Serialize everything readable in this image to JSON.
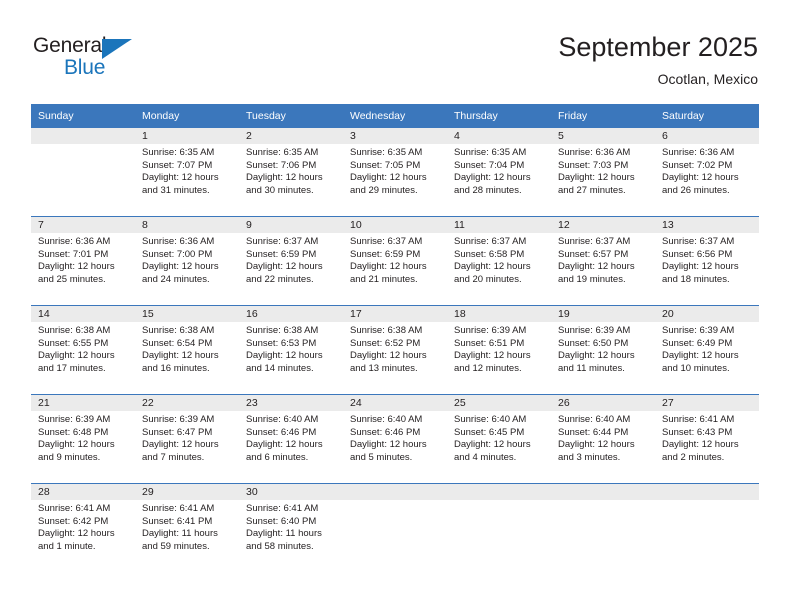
{
  "brand": {
    "name_part1": "General",
    "name_part2": "Blue",
    "triangle_icon": "triangle-icon",
    "accent_color": "#1b75bb"
  },
  "header": {
    "title": "September 2025",
    "subtitle": "Ocotlan, Mexico"
  },
  "calendar": {
    "header_color": "#3b77bc",
    "weekday_headers": [
      "Sunday",
      "Monday",
      "Tuesday",
      "Wednesday",
      "Thursday",
      "Friday",
      "Saturday"
    ],
    "weeks": [
      [
        {
          "day": "",
          "sunrise": "",
          "sunset": "",
          "daylight1": "",
          "daylight2": ""
        },
        {
          "day": "1",
          "sunrise": "Sunrise: 6:35 AM",
          "sunset": "Sunset: 7:07 PM",
          "daylight1": "Daylight: 12 hours",
          "daylight2": "and 31 minutes."
        },
        {
          "day": "2",
          "sunrise": "Sunrise: 6:35 AM",
          "sunset": "Sunset: 7:06 PM",
          "daylight1": "Daylight: 12 hours",
          "daylight2": "and 30 minutes."
        },
        {
          "day": "3",
          "sunrise": "Sunrise: 6:35 AM",
          "sunset": "Sunset: 7:05 PM",
          "daylight1": "Daylight: 12 hours",
          "daylight2": "and 29 minutes."
        },
        {
          "day": "4",
          "sunrise": "Sunrise: 6:35 AM",
          "sunset": "Sunset: 7:04 PM",
          "daylight1": "Daylight: 12 hours",
          "daylight2": "and 28 minutes."
        },
        {
          "day": "5",
          "sunrise": "Sunrise: 6:36 AM",
          "sunset": "Sunset: 7:03 PM",
          "daylight1": "Daylight: 12 hours",
          "daylight2": "and 27 minutes."
        },
        {
          "day": "6",
          "sunrise": "Sunrise: 6:36 AM",
          "sunset": "Sunset: 7:02 PM",
          "daylight1": "Daylight: 12 hours",
          "daylight2": "and 26 minutes."
        }
      ],
      [
        {
          "day": "7",
          "sunrise": "Sunrise: 6:36 AM",
          "sunset": "Sunset: 7:01 PM",
          "daylight1": "Daylight: 12 hours",
          "daylight2": "and 25 minutes."
        },
        {
          "day": "8",
          "sunrise": "Sunrise: 6:36 AM",
          "sunset": "Sunset: 7:00 PM",
          "daylight1": "Daylight: 12 hours",
          "daylight2": "and 24 minutes."
        },
        {
          "day": "9",
          "sunrise": "Sunrise: 6:37 AM",
          "sunset": "Sunset: 6:59 PM",
          "daylight1": "Daylight: 12 hours",
          "daylight2": "and 22 minutes."
        },
        {
          "day": "10",
          "sunrise": "Sunrise: 6:37 AM",
          "sunset": "Sunset: 6:59 PM",
          "daylight1": "Daylight: 12 hours",
          "daylight2": "and 21 minutes."
        },
        {
          "day": "11",
          "sunrise": "Sunrise: 6:37 AM",
          "sunset": "Sunset: 6:58 PM",
          "daylight1": "Daylight: 12 hours",
          "daylight2": "and 20 minutes."
        },
        {
          "day": "12",
          "sunrise": "Sunrise: 6:37 AM",
          "sunset": "Sunset: 6:57 PM",
          "daylight1": "Daylight: 12 hours",
          "daylight2": "and 19 minutes."
        },
        {
          "day": "13",
          "sunrise": "Sunrise: 6:37 AM",
          "sunset": "Sunset: 6:56 PM",
          "daylight1": "Daylight: 12 hours",
          "daylight2": "and 18 minutes."
        }
      ],
      [
        {
          "day": "14",
          "sunrise": "Sunrise: 6:38 AM",
          "sunset": "Sunset: 6:55 PM",
          "daylight1": "Daylight: 12 hours",
          "daylight2": "and 17 minutes."
        },
        {
          "day": "15",
          "sunrise": "Sunrise: 6:38 AM",
          "sunset": "Sunset: 6:54 PM",
          "daylight1": "Daylight: 12 hours",
          "daylight2": "and 16 minutes."
        },
        {
          "day": "16",
          "sunrise": "Sunrise: 6:38 AM",
          "sunset": "Sunset: 6:53 PM",
          "daylight1": "Daylight: 12 hours",
          "daylight2": "and 14 minutes."
        },
        {
          "day": "17",
          "sunrise": "Sunrise: 6:38 AM",
          "sunset": "Sunset: 6:52 PM",
          "daylight1": "Daylight: 12 hours",
          "daylight2": "and 13 minutes."
        },
        {
          "day": "18",
          "sunrise": "Sunrise: 6:39 AM",
          "sunset": "Sunset: 6:51 PM",
          "daylight1": "Daylight: 12 hours",
          "daylight2": "and 12 minutes."
        },
        {
          "day": "19",
          "sunrise": "Sunrise: 6:39 AM",
          "sunset": "Sunset: 6:50 PM",
          "daylight1": "Daylight: 12 hours",
          "daylight2": "and 11 minutes."
        },
        {
          "day": "20",
          "sunrise": "Sunrise: 6:39 AM",
          "sunset": "Sunset: 6:49 PM",
          "daylight1": "Daylight: 12 hours",
          "daylight2": "and 10 minutes."
        }
      ],
      [
        {
          "day": "21",
          "sunrise": "Sunrise: 6:39 AM",
          "sunset": "Sunset: 6:48 PM",
          "daylight1": "Daylight: 12 hours",
          "daylight2": "and 9 minutes."
        },
        {
          "day": "22",
          "sunrise": "Sunrise: 6:39 AM",
          "sunset": "Sunset: 6:47 PM",
          "daylight1": "Daylight: 12 hours",
          "daylight2": "and 7 minutes."
        },
        {
          "day": "23",
          "sunrise": "Sunrise: 6:40 AM",
          "sunset": "Sunset: 6:46 PM",
          "daylight1": "Daylight: 12 hours",
          "daylight2": "and 6 minutes."
        },
        {
          "day": "24",
          "sunrise": "Sunrise: 6:40 AM",
          "sunset": "Sunset: 6:46 PM",
          "daylight1": "Daylight: 12 hours",
          "daylight2": "and 5 minutes."
        },
        {
          "day": "25",
          "sunrise": "Sunrise: 6:40 AM",
          "sunset": "Sunset: 6:45 PM",
          "daylight1": "Daylight: 12 hours",
          "daylight2": "and 4 minutes."
        },
        {
          "day": "26",
          "sunrise": "Sunrise: 6:40 AM",
          "sunset": "Sunset: 6:44 PM",
          "daylight1": "Daylight: 12 hours",
          "daylight2": "and 3 minutes."
        },
        {
          "day": "27",
          "sunrise": "Sunrise: 6:41 AM",
          "sunset": "Sunset: 6:43 PM",
          "daylight1": "Daylight: 12 hours",
          "daylight2": "and 2 minutes."
        }
      ],
      [
        {
          "day": "28",
          "sunrise": "Sunrise: 6:41 AM",
          "sunset": "Sunset: 6:42 PM",
          "daylight1": "Daylight: 12 hours",
          "daylight2": "and 1 minute."
        },
        {
          "day": "29",
          "sunrise": "Sunrise: 6:41 AM",
          "sunset": "Sunset: 6:41 PM",
          "daylight1": "Daylight: 11 hours",
          "daylight2": "and 59 minutes."
        },
        {
          "day": "30",
          "sunrise": "Sunrise: 6:41 AM",
          "sunset": "Sunset: 6:40 PM",
          "daylight1": "Daylight: 11 hours",
          "daylight2": "and 58 minutes."
        },
        {
          "day": "",
          "sunrise": "",
          "sunset": "",
          "daylight1": "",
          "daylight2": ""
        },
        {
          "day": "",
          "sunrise": "",
          "sunset": "",
          "daylight1": "",
          "daylight2": ""
        },
        {
          "day": "",
          "sunrise": "",
          "sunset": "",
          "daylight1": "",
          "daylight2": ""
        },
        {
          "day": "",
          "sunrise": "",
          "sunset": "",
          "daylight1": "",
          "daylight2": ""
        }
      ]
    ]
  }
}
